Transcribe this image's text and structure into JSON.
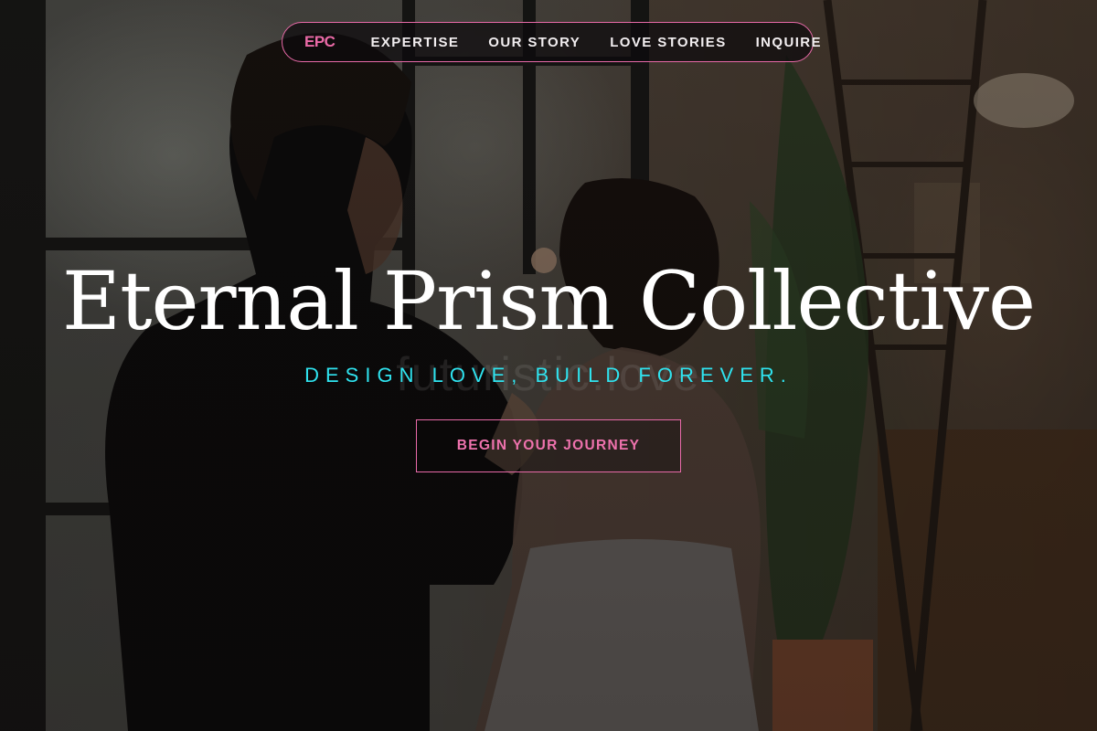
{
  "nav": {
    "brand": "EPC",
    "links": [
      {
        "label": "EXPERTISE"
      },
      {
        "label": "OUR STORY"
      },
      {
        "label": "LOVE STORIES"
      },
      {
        "label": "INQUIRE"
      }
    ]
  },
  "hero": {
    "title": "Eternal Prism Collective",
    "tagline": "DESIGN LOVE, BUILD FOREVER.",
    "watermark": "futuristic.love",
    "cta_label": "BEGIN YOUR JOURNEY"
  },
  "colors": {
    "accent_pink": "#e86aa8",
    "accent_cyan": "#2fe3ef",
    "title": "#ffffff"
  }
}
